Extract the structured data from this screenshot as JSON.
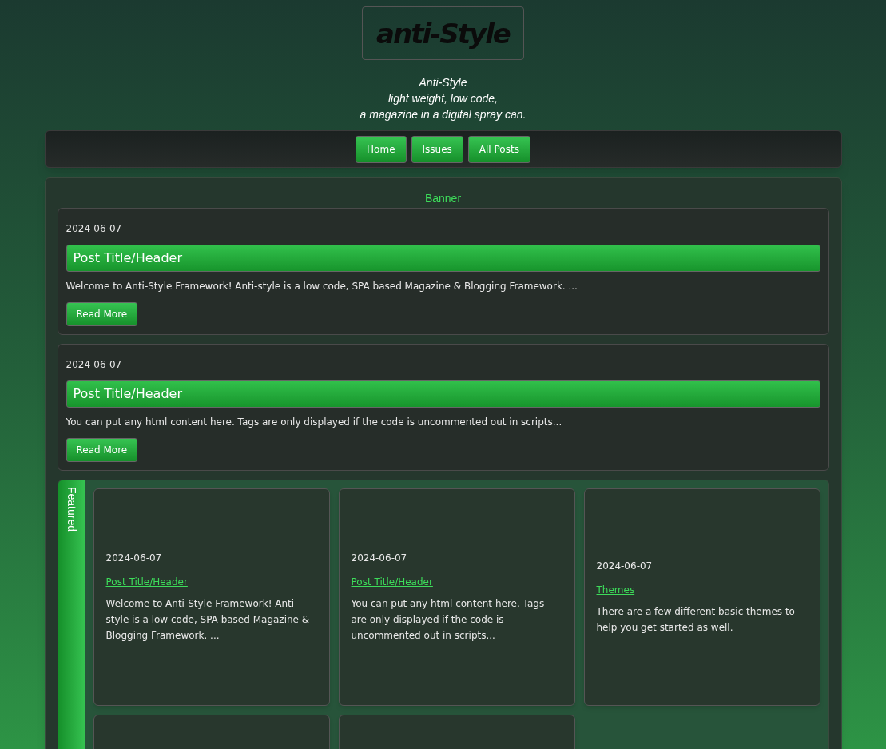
{
  "logo": {
    "text": "anti-Style"
  },
  "tagline": [
    "Anti-Style",
    "light weight, low code,",
    "a magazine in a digital spray can."
  ],
  "nav": [
    {
      "label": "Home"
    },
    {
      "label": "Issues"
    },
    {
      "label": "All Posts"
    }
  ],
  "banner": {
    "heading": "Banner",
    "posts": [
      {
        "date": "2024-06-07",
        "title": "Post Title/Header",
        "excerpt": "Welcome to Anti-Style Framework! Anti-style is a low code, SPA based Magazine & Blogging Framework. ...",
        "button": "Read More"
      },
      {
        "date": "2024-06-07",
        "title": "Post Title/Header",
        "excerpt": "You can put any html content here. Tags are only displayed if the code is uncommented out in scripts...",
        "button": "Read More"
      }
    ]
  },
  "featured": {
    "label": "Featured",
    "cards": [
      {
        "kind": "post",
        "date": "2024-06-07",
        "title": "Post Title/Header",
        "excerpt": "Welcome to Anti-Style Framework! Anti-style is a low code, SPA based Magazine & Blogging Framework. ..."
      },
      {
        "kind": "post",
        "date": "2024-06-07",
        "title": "Post Title/Header",
        "excerpt": "You can put any html content here. Tags are only displayed if the code is uncommented out in scripts..."
      },
      {
        "kind": "post",
        "date": "2024-06-07",
        "title": "Themes",
        "excerpt": "There are a few different basic themes to help you get started as well."
      },
      {
        "kind": "blank"
      },
      {
        "kind": "blank"
      }
    ]
  }
}
